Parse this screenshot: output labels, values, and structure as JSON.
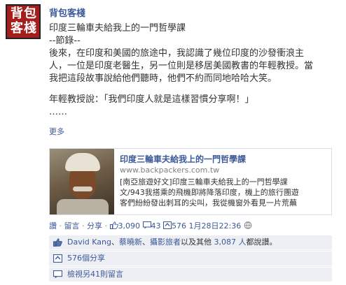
{
  "post": {
    "author": "背包客棧",
    "avatar_text": [
      "背",
      "包",
      "客",
      "棧"
    ],
    "lines": [
      "印度三輪車夫給我上的一門哲學課",
      "--節錄--",
      "後來，在印度和美國的旅途中，我認識了幾位印度的沙發衝浪主",
      "人，一位是印度老醫生，另一位則是移居美國教書的年輕教授。當",
      "我把這段故事說給他們聽時，他們不約而同地哈哈大笑。"
    ],
    "quote": "年輕教授說：「我們印度人就是這樣習慣分享啊！」",
    "ellipsis": "……",
    "more_label": "更多"
  },
  "shared_link": {
    "title": "印度三輪車夫給我上的一門哲學課",
    "url": "www.backpackers.com.tw",
    "description": [
      "[南亞旅遊好文]印度三輪車夫給我上的一門哲學課",
      "文/943我搭乘的飛機即將降落印度，機上的旅行團遊",
      "客們紛紛發出刺耳的尖叫，我從機窗外看見一片荒蕪"
    ],
    "image_icon": "man-with-turban-photo"
  },
  "actions": {
    "like": "讚",
    "comment": "留言",
    "share": "分享",
    "like_count": "3,090",
    "comment_count": "43",
    "share_count": "576",
    "timestamp": "1月28日22:36",
    "sep": "·",
    "privacy_icon": "globe-icon"
  },
  "ufi": {
    "liker_1": "David Kang",
    "sep": "、",
    "liker_2": "蔡曉新",
    "liker_3": "攝影旅者",
    "and_word": "以及其他",
    "others_count": "3,087 人",
    "liked_suffix": "都說讚。",
    "shares_label": "576個分享",
    "comments_label": "檢視另41則留言"
  },
  "colors": {
    "link": "#3b5998",
    "ufi_bg": "#edeff4",
    "avatar_bg": "#a41e1e"
  }
}
